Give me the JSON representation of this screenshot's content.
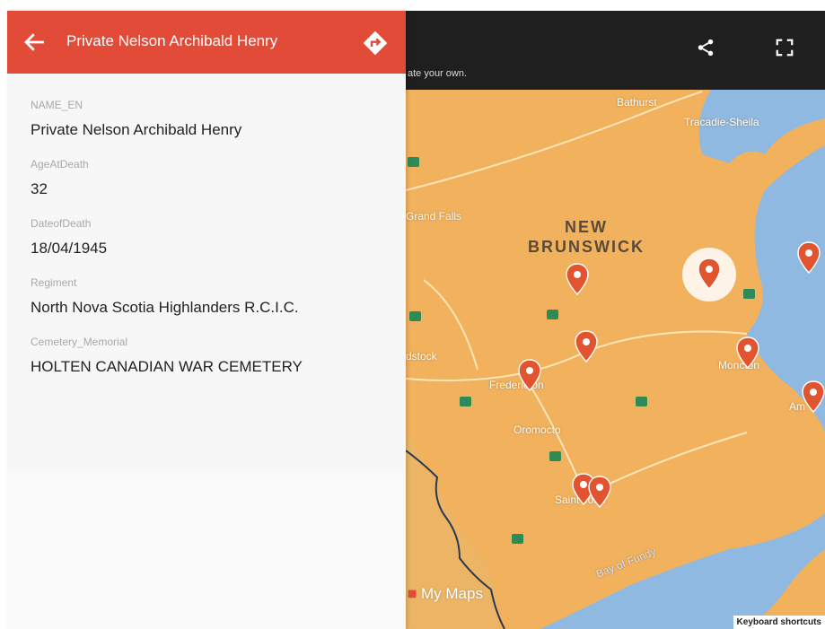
{
  "panel": {
    "title": "Private Nelson Archibald Henry",
    "attributes": [
      {
        "label": "NAME_EN",
        "value": "Private Nelson Archibald Henry"
      },
      {
        "label": "AgeAtDeath",
        "value": "32"
      },
      {
        "label": "DateofDeath",
        "value": "18/04/1945"
      },
      {
        "label": "Regiment",
        "value": "North Nova Scotia Highlanders R.C.I.C."
      },
      {
        "label": "Cemetery_Memorial",
        "value": "HOLTEN CANADIAN WAR CEMETERY"
      }
    ]
  },
  "map": {
    "topbar_hint": "ate your own.",
    "province": [
      "NEW",
      "BRUNSWICK"
    ],
    "places": [
      "Bathurst",
      "Tracadie-Sheila",
      "Grand Falls",
      "dstock",
      "Fredericton",
      "Oromocto",
      "Saint John",
      "Moncton",
      "Am",
      "Bay of Fundy"
    ],
    "watermark": "My Maps",
    "keyboard_shortcuts": "Keyboard shortcuts",
    "icons": [
      "share-icon",
      "fullscreen-icon"
    ]
  },
  "colors": {
    "header": "#e24b37",
    "land": "#f2b15d",
    "water": "#8fb9e0",
    "pin": "#e25330"
  }
}
